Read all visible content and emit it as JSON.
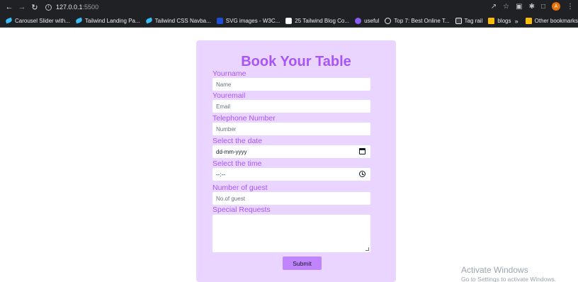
{
  "browser": {
    "url_host": "127.0.0.1",
    "url_port": ":5500",
    "avatar_initial": "A"
  },
  "bookmarks": [
    {
      "label": "Carousel Slider with...",
      "icon": "tailwind-icon"
    },
    {
      "label": "Tailwind Landing Pa...",
      "icon": "tailwind-icon"
    },
    {
      "label": "Tailwind CSS Navba...",
      "icon": "tailwind-icon"
    },
    {
      "label": "SVG images - W3C...",
      "icon": "w3schools-icon"
    },
    {
      "label": "25 Tailwind Blog Co...",
      "icon": "blog-icon"
    },
    {
      "label": "useful",
      "icon": "heart-icon"
    },
    {
      "label": "Top 7: Best Online T...",
      "icon": "globe-icon"
    },
    {
      "label": "Tag rail",
      "icon": "tag-icon"
    },
    {
      "label": "blogs",
      "icon": "folder-icon"
    }
  ],
  "bookmarks_more": "»",
  "other_bookmarks": "Other bookmarks",
  "form": {
    "title": "Book Your Table",
    "name_label": "Yourname",
    "name_placeholder": "Name",
    "email_label": "Youremail",
    "email_placeholder": "Email",
    "phone_label": "Telephone Number",
    "phone_placeholder": "Number",
    "date_label": "Select the date",
    "date_value": "dd-mm-yyyy",
    "time_label": "Select the time",
    "time_value": "--:--",
    "guest_label": "Number of guest",
    "guest_placeholder": "No.of guest",
    "requests_label": "Special Requests",
    "submit_label": "Submit"
  },
  "watermark": {
    "line1": "Activate Windows",
    "line2": "Go to Settings to activate Windows."
  },
  "colors": {
    "card_bg": "#e9d5ff",
    "accent": "#a855f7",
    "button": "#c084fc",
    "chrome": "#202124"
  }
}
